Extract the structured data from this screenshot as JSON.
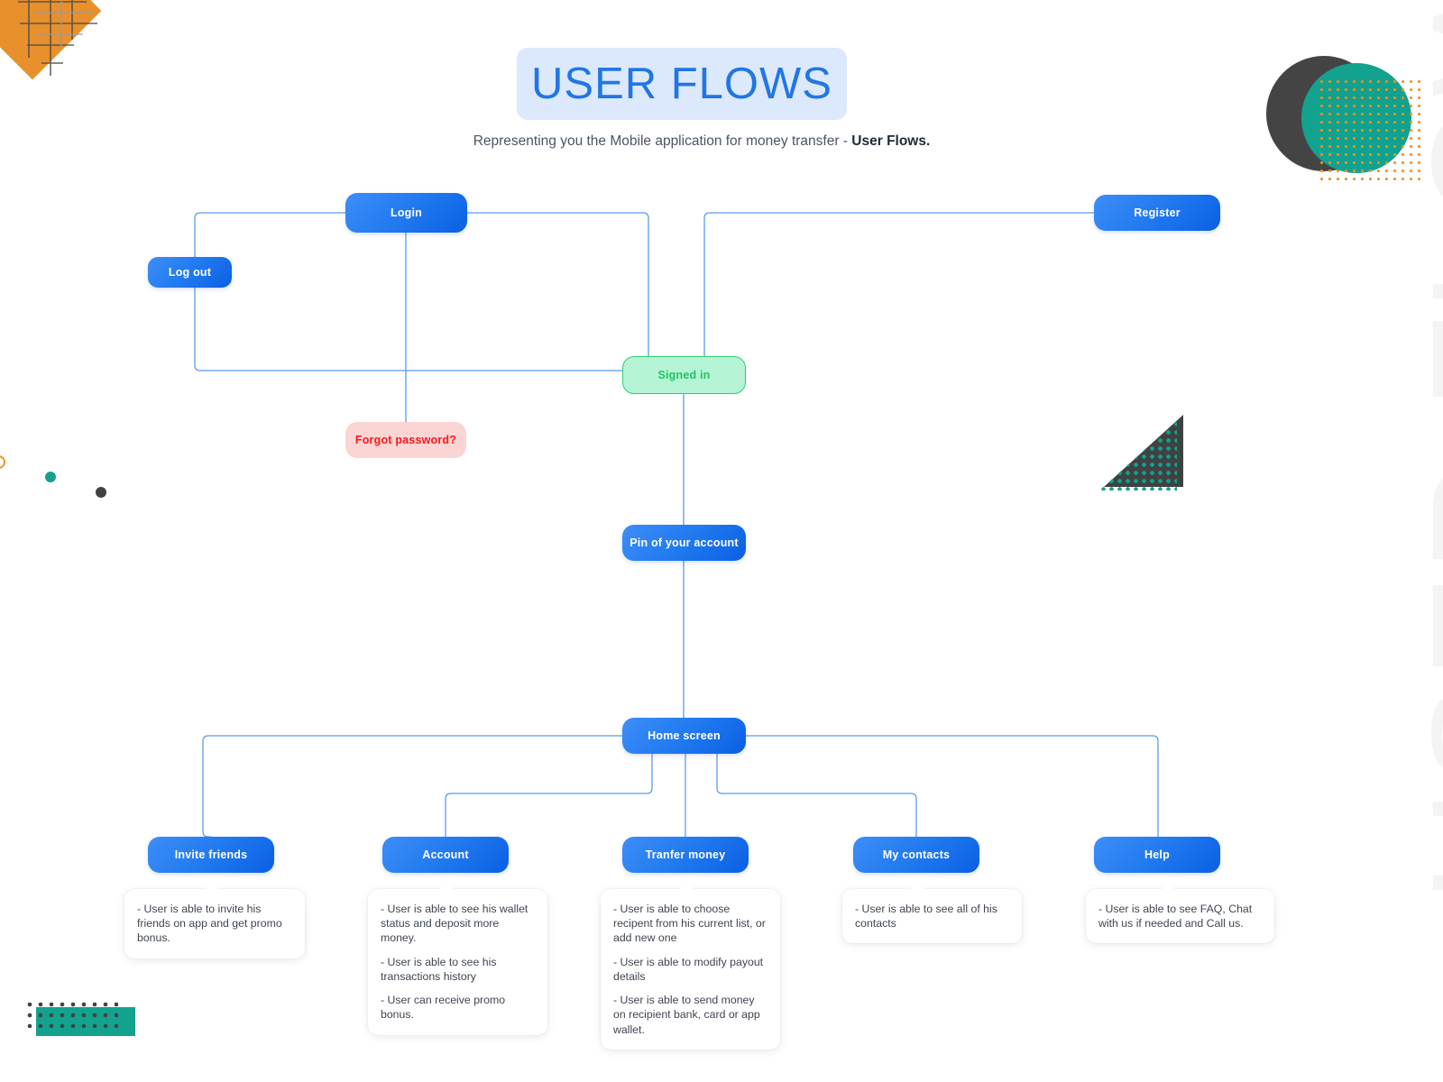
{
  "header": {
    "title": "USER FLOWS",
    "subtitle_plain": "Representing you the Mobile application for money transfer - ",
    "subtitle_bold": "User Flows.",
    "watermark": "USER FLOW"
  },
  "nodes": {
    "login": "Login",
    "logout": "Log out",
    "register": "Register",
    "signed_in": "Signed in",
    "forgot_password": "Forgot password?",
    "pin": "Pin of your account",
    "home": "Home screen",
    "invite_friends": "Invite friends",
    "account": "Account",
    "transfer_money": "Tranfer money",
    "my_contacts": "My contacts",
    "help": "Help"
  },
  "callouts": {
    "invite_friends": [
      "- User is able to invite his friends on app and get promo bonus."
    ],
    "account": [
      "- User is able to see his wallet status and deposit more money.",
      "- User is able to see his transactions history",
      "- User can receive promo bonus."
    ],
    "transfer_money": [
      "- User is able to choose recipent from his current list, or add new one",
      "- User is able to modify payout  details",
      "- User is able to send money on recipient bank, card or app wallet."
    ],
    "my_contacts": [
      "- User is able to see all of his contacts"
    ],
    "help": [
      "- User is able to see FAQ, Chat with us if needed and Call us."
    ]
  },
  "colors": {
    "node_blue_light": "#3d8ef7",
    "node_blue_dark": "#0b5fe4",
    "title_blue": "#2176e4",
    "title_pill_bg": "#dce9fc",
    "green_bg": "#b5f5d6",
    "green_text": "#22c263",
    "green_border": "#2ecc71",
    "red_bg": "#fbd4d4",
    "red_text": "#f81919",
    "connector": "#5b9bf0",
    "orange": "#e8902c",
    "teal": "#12a28e",
    "dark": "#3f4243",
    "watermark": "#f4f4f5"
  }
}
